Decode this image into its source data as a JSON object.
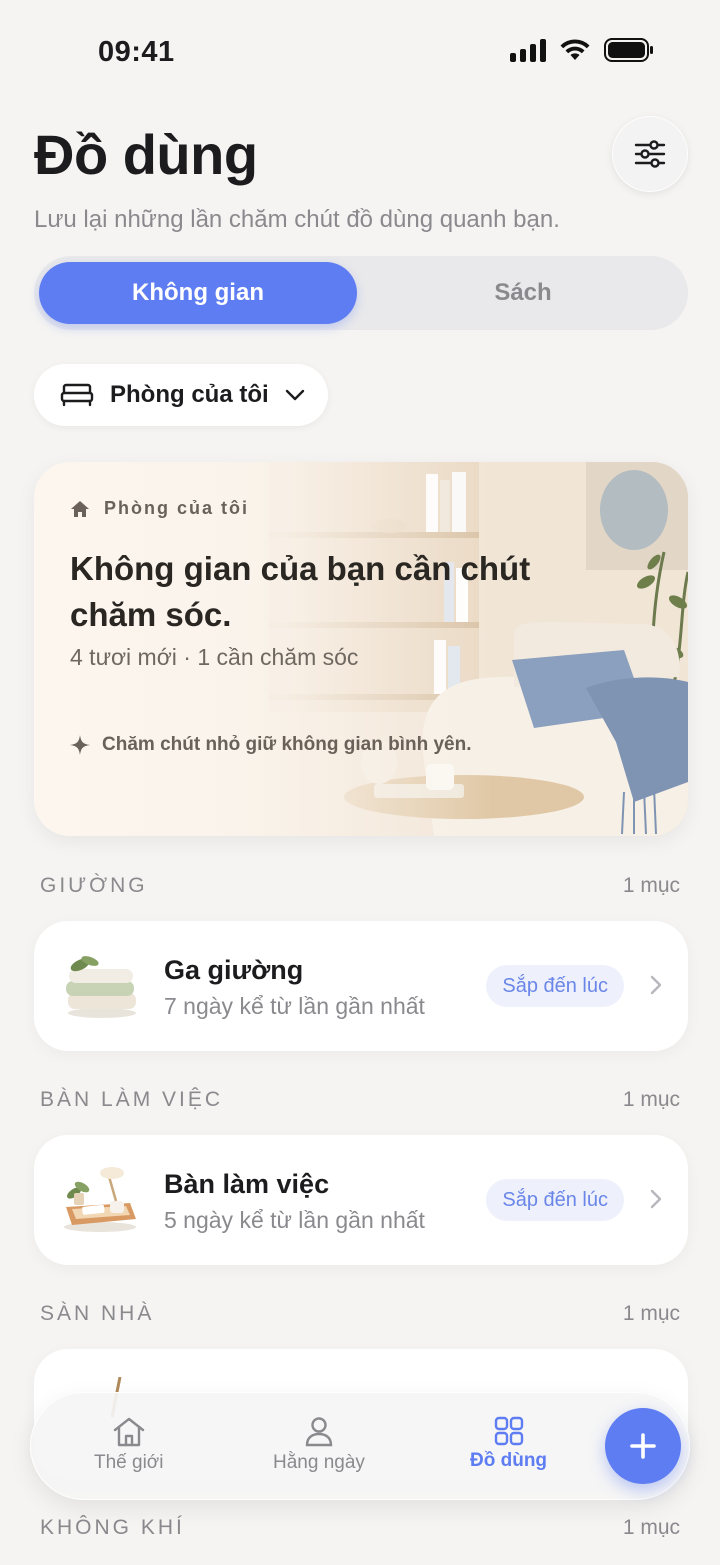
{
  "status_bar": {
    "time": "09:41"
  },
  "header": {
    "title": "Đồ dùng",
    "subtitle": "Lưu lại những lần chăm chút đồ dùng quanh bạn."
  },
  "segments": {
    "active": "Không gian",
    "inactive": "Sách"
  },
  "room_picker": {
    "label": "Phòng của tôi"
  },
  "hero": {
    "kicker": "Phòng của tôi",
    "title": "Không gian của bạn cần chút chăm sóc.",
    "stats": "4 tươi mới · 1 cần chăm sóc",
    "tip": "Chăm chút nhỏ giữ không gian bình yên."
  },
  "sections": [
    {
      "name": "GIƯỜNG",
      "count": "1 mục",
      "item": {
        "name": "Ga giường",
        "sub": "7 ngày kể từ lần gần nhất",
        "badge": "Sắp đến lúc"
      }
    },
    {
      "name": "BÀN LÀM VIỆC",
      "count": "1 mục",
      "item": {
        "name": "Bàn làm việc",
        "sub": "5 ngày kể từ lần gần nhất",
        "badge": "Sắp đến lúc"
      }
    },
    {
      "name": "SÀN NHÀ",
      "count": "1 mục"
    },
    {
      "name": "KHÔNG KHÍ",
      "count": "1 mục"
    }
  ],
  "tabbar": {
    "world": "Thế giới",
    "daily": "Hằng ngày",
    "items": "Đồ dùng"
  },
  "colors": {
    "accent": "#5f7df2",
    "badge_bg": "#eef1fc",
    "background": "#f5f4f2"
  }
}
